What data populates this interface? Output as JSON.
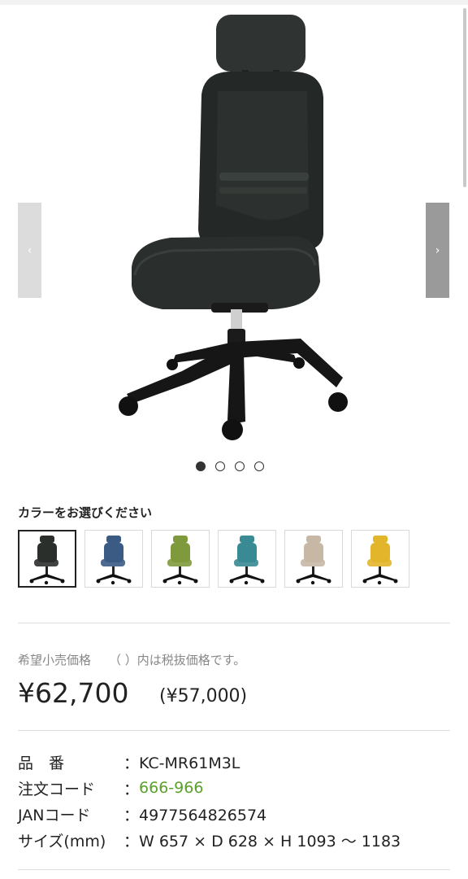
{
  "gallery": {
    "prev_label": "‹",
    "next_label": "›",
    "slide_count": 4,
    "active_slide": 1
  },
  "color_select": {
    "title": "カラーをお選びください",
    "selected_index": 0,
    "options": [
      {
        "name": "black",
        "hex": "#2b2f2c"
      },
      {
        "name": "blue",
        "hex": "#3b5a84"
      },
      {
        "name": "green",
        "hex": "#7f9a3c"
      },
      {
        "name": "teal",
        "hex": "#3a8a93"
      },
      {
        "name": "beige",
        "hex": "#c7b8a6"
      },
      {
        "name": "yellow",
        "hex": "#e2b52b"
      }
    ]
  },
  "price": {
    "label": "希望小売価格",
    "note": "（ ）内は税抜価格です。",
    "with_tax": "¥62,700",
    "without_tax": "(¥57,000)"
  },
  "specs": [
    {
      "label": "品　番",
      "value": "：KC-MR61M3L"
    },
    {
      "label": "注文コード",
      "value": "：",
      "link": "666-966"
    },
    {
      "label": "JANコード",
      "value": "：4977564826574"
    },
    {
      "label": "サイズ(mm)",
      "value": "：W 657 × D 628 × H 1093 〜 1183"
    }
  ],
  "colors": {
    "link_green": "#5aa02c"
  }
}
